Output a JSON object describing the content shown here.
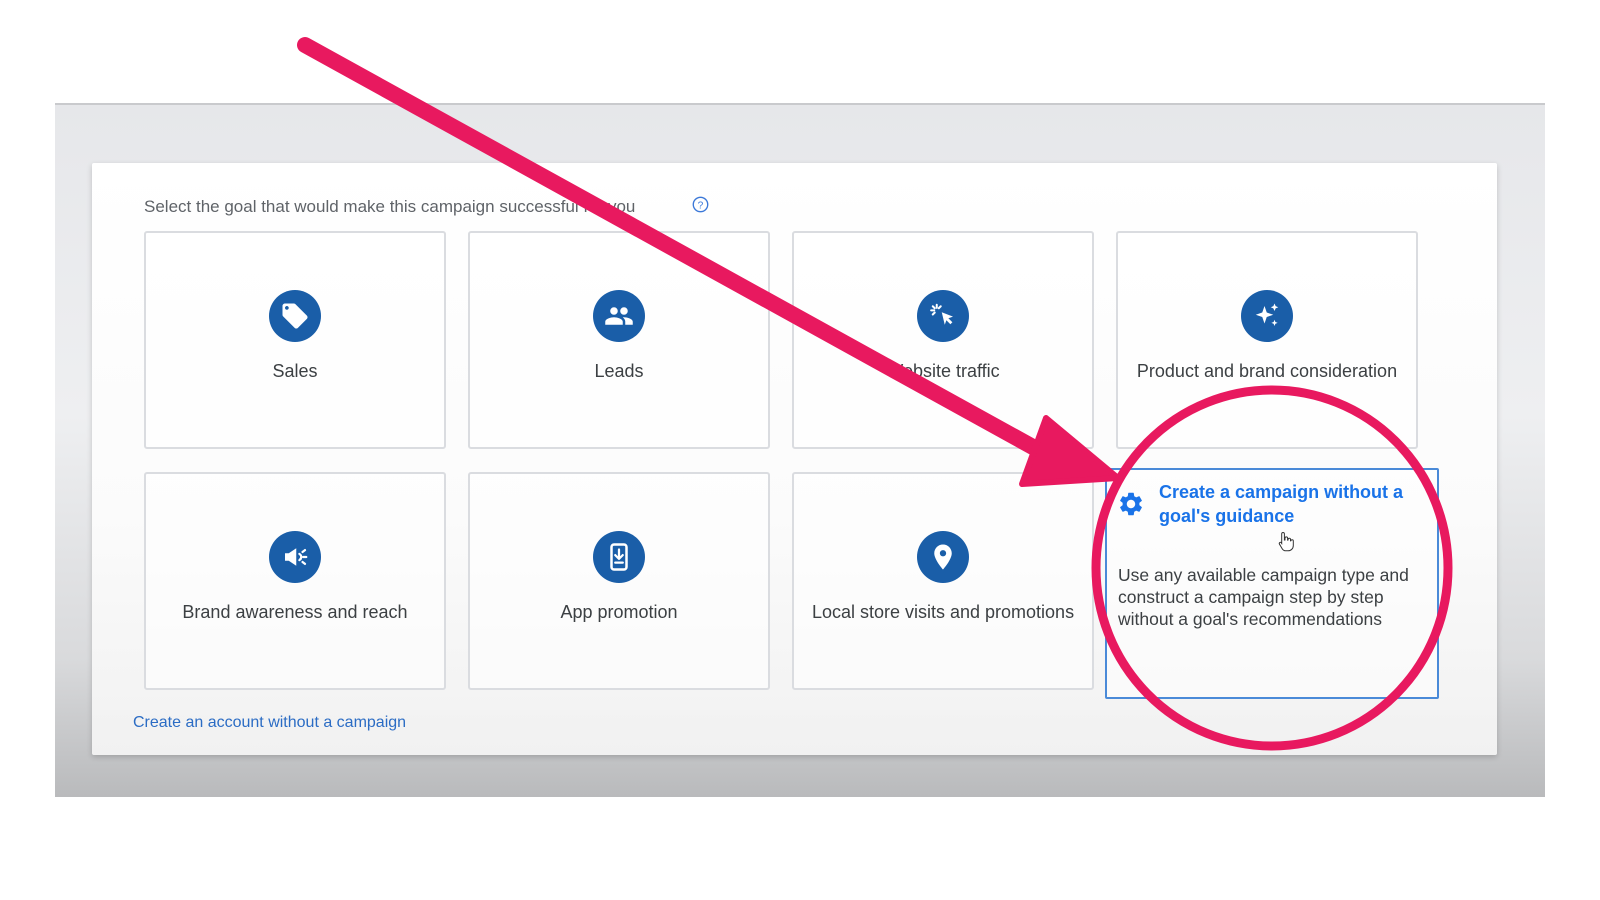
{
  "colors": {
    "icon_blue": "#1a5ea8",
    "link_blue": "#1a73e8",
    "annotation_pink": "#e8195f"
  },
  "heading": "Select the goal that would make this campaign successful for you",
  "goals": [
    {
      "label": "Sales",
      "icon": "tag-icon"
    },
    {
      "label": "Leads",
      "icon": "people-icon"
    },
    {
      "label": "Website traffic",
      "icon": "cursor-click-icon"
    },
    {
      "label": "Product and brand consideration",
      "icon": "sparkle-icon"
    },
    {
      "label": "Brand awareness and reach",
      "icon": "megaphone-icon"
    },
    {
      "label": "App promotion",
      "icon": "phone-download-icon"
    },
    {
      "label": "Local store visits and promotions",
      "icon": "location-pin-icon"
    }
  ],
  "no_goal_option": {
    "title": "Create a campaign without a goal's guidance",
    "description": "Use any available campaign type and construct a campaign step by step without a goal's recommendations",
    "icon": "gear-icon"
  },
  "footer_link": "Create an account without a campaign"
}
